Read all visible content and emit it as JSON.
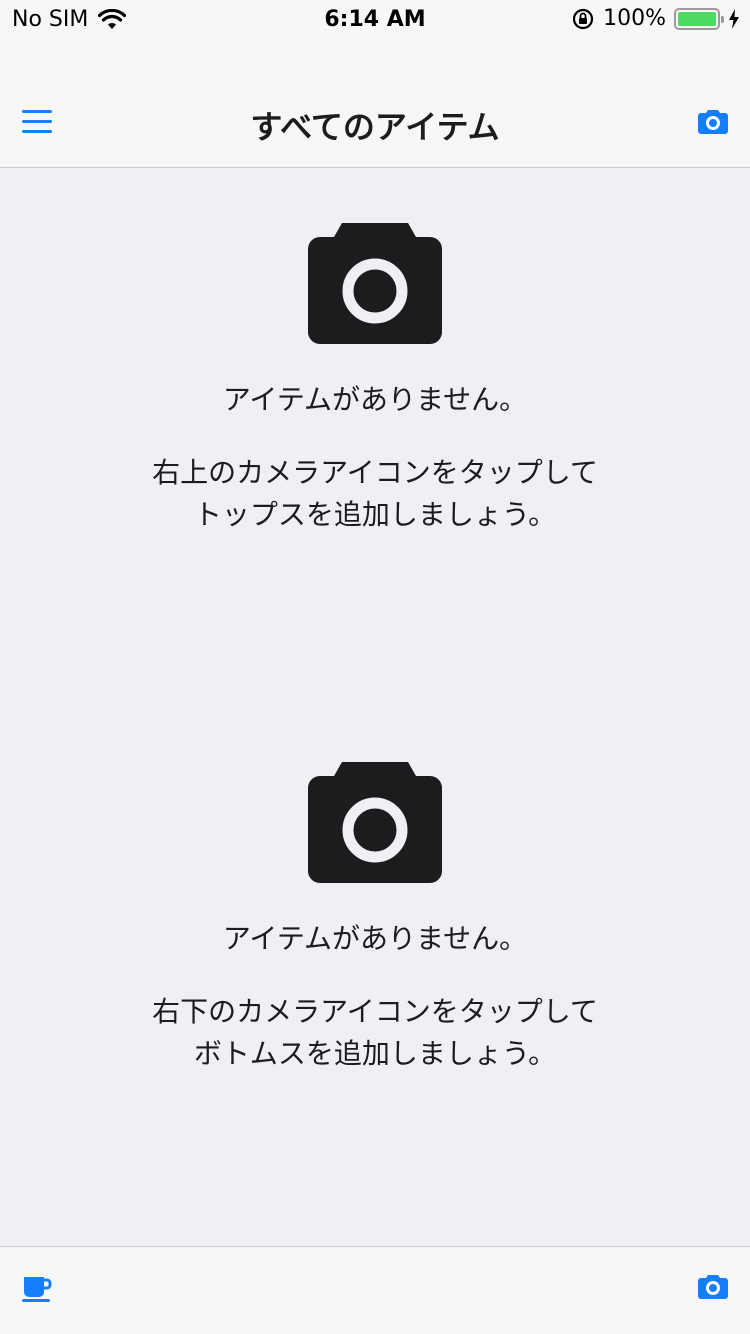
{
  "status_bar": {
    "carrier": "No SIM",
    "time": "6:14 AM",
    "battery": "100%",
    "battery_level": 1.0
  },
  "nav": {
    "title": "すべてのアイテム",
    "menu_icon": "hamburger-menu-icon",
    "camera_icon": "camera-icon"
  },
  "sections": [
    {
      "icon": "camera-icon",
      "title": "アイテムがありません。",
      "desc_line1": "右上のカメラアイコンをタップして",
      "desc_line2": "トップスを追加しましょう。"
    },
    {
      "icon": "camera-icon",
      "title": "アイテムがありません。",
      "desc_line1": "右下のカメラアイコンをタップして",
      "desc_line2": "ボトムスを追加しましょう。"
    }
  ],
  "toolbar": {
    "left_icon": "coffee-cup-icon",
    "right_icon": "camera-icon"
  },
  "colors": {
    "accent": "#147efb",
    "background": "#efeff4",
    "bar": "#f7f7f7",
    "icon_dark": "#1c1c1e",
    "battery_green": "#4cd964"
  }
}
